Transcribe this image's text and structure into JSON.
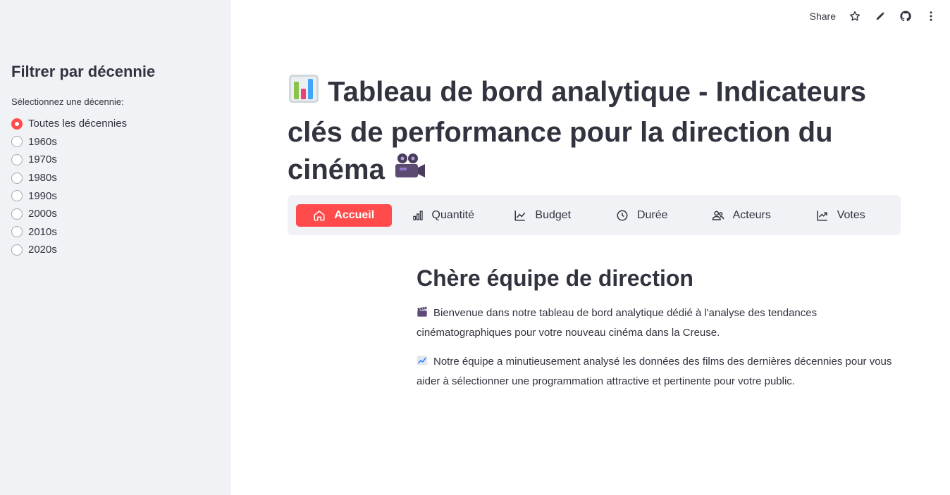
{
  "sidebar": {
    "title": "Filtrer par décennie",
    "label": "Sélectionnez une décennie:",
    "options": [
      {
        "label": "Toutes les décennies",
        "selected": true
      },
      {
        "label": "1960s",
        "selected": false
      },
      {
        "label": "1970s",
        "selected": false
      },
      {
        "label": "1980s",
        "selected": false
      },
      {
        "label": "1990s",
        "selected": false
      },
      {
        "label": "2000s",
        "selected": false
      },
      {
        "label": "2010s",
        "selected": false
      },
      {
        "label": "2020s",
        "selected": false
      }
    ]
  },
  "toolbar": {
    "share_label": "Share",
    "icons": [
      "star-icon",
      "edit-icon",
      "github-icon",
      "more-icon"
    ]
  },
  "main": {
    "title_text": "Tableau de bord analytique - Indicateurs clés de performance pour la direction du cinéma",
    "title_icons": [
      "bar-chart-emoji",
      "movie-camera-emoji"
    ]
  },
  "nav": {
    "items": [
      {
        "label": "Accueil",
        "icon": "home-icon",
        "active": true
      },
      {
        "label": "Quantité",
        "icon": "bar-chart-icon",
        "active": false
      },
      {
        "label": "Budget",
        "icon": "line-chart-icon",
        "active": false
      },
      {
        "label": "Durée",
        "icon": "clock-icon",
        "active": false
      },
      {
        "label": "Acteurs",
        "icon": "people-icon",
        "active": false
      },
      {
        "label": "Votes",
        "icon": "trend-up-icon",
        "active": false
      }
    ],
    "active_color": "#ff4b4b"
  },
  "content": {
    "heading": "Chère équipe de direction",
    "paragraphs": [
      {
        "emoji": "clapper-board-emoji",
        "text": "Bienvenue dans notre tableau de bord analytique dédié à l'analyse des tendances cinématographiques pour votre nouveau cinéma dans la Creuse."
      },
      {
        "emoji": "chart-increasing-emoji",
        "text": "Notre équipe a minutieusement analysé les données des films des dernières décennies pour vous aider à sélectionner une programmation attractive et pertinente pour votre public."
      }
    ]
  },
  "colors": {
    "sidebar_bg": "#f0f2f6",
    "accent": "#ff4b4b",
    "text": "#31333f"
  }
}
